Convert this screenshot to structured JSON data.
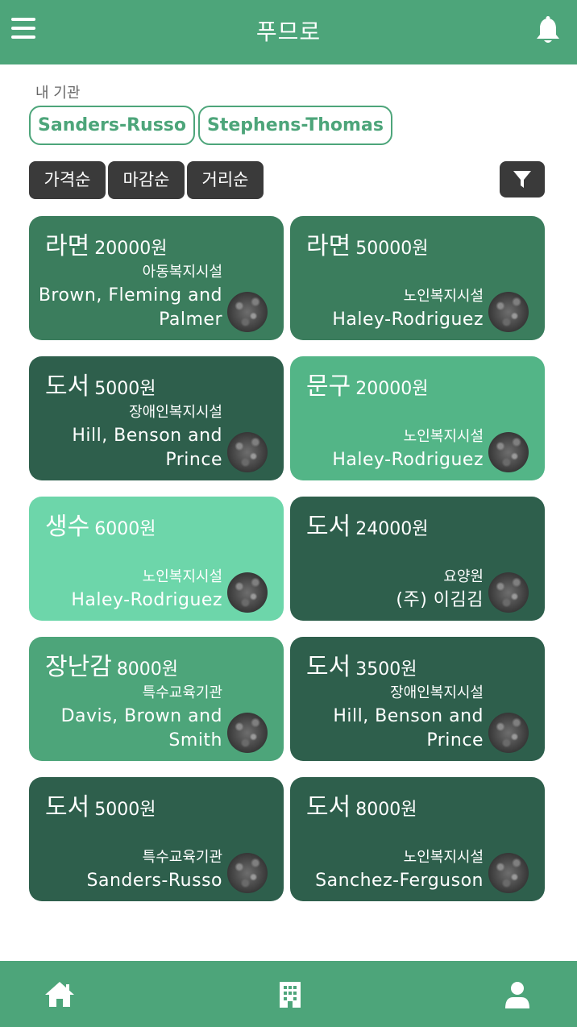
{
  "header": {
    "title": "푸므로",
    "menu_icon": "hamburger-menu-icon",
    "bell_icon": "bell-icon"
  },
  "my_institutions": {
    "label": "내 기관",
    "chips": [
      "Sanders-Russo",
      "Stephens-Thomas"
    ]
  },
  "sort": {
    "options": [
      "가격순",
      "마감순",
      "거리순"
    ],
    "filter_icon": "filter-icon"
  },
  "colors": {
    "brand": "#4da57a",
    "dark_button": "#3a3a3a"
  },
  "cards": [
    {
      "category": "라면",
      "price": "20000원",
      "type": "아동복지시설",
      "org": "Brown, Fleming and Palmer",
      "color": "#3b7d5d"
    },
    {
      "category": "라면",
      "price": "50000원",
      "type": "노인복지시설",
      "org": "Haley-Rodriguez",
      "color": "#3b7d5d"
    },
    {
      "category": "도서",
      "price": "5000원",
      "type": "장애인복지시설",
      "org": "Hill, Benson and Prince",
      "color": "#2e5f4c"
    },
    {
      "category": "문구",
      "price": "20000원",
      "type": "노인복지시설",
      "org": "Haley-Rodriguez",
      "color": "#53b587"
    },
    {
      "category": "생수",
      "price": "6000원",
      "type": "노인복지시설",
      "org": "Haley-Rodriguez",
      "color": "#6dd6aa"
    },
    {
      "category": "도서",
      "price": "24000원",
      "type": "요양원",
      "org": "(주) 이김김",
      "color": "#2e5f4c"
    },
    {
      "category": "장난감",
      "price": "8000원",
      "type": "특수교육기관",
      "org": "Davis, Brown and Smith",
      "color": "#4da57a"
    },
    {
      "category": "도서",
      "price": "3500원",
      "type": "장애인복지시설",
      "org": "Hill, Benson and Prince",
      "color": "#2e5f4c"
    },
    {
      "category": "도서",
      "price": "5000원",
      "type": "특수교육기관",
      "org": "Sanders-Russo",
      "color": "#2e5f4c"
    },
    {
      "category": "도서",
      "price": "8000원",
      "type": "노인복지시설",
      "org": "Sanchez-Ferguson",
      "color": "#2e5f4c"
    }
  ],
  "bottom_nav": {
    "items": [
      "home-icon",
      "building-icon",
      "user-icon"
    ]
  }
}
